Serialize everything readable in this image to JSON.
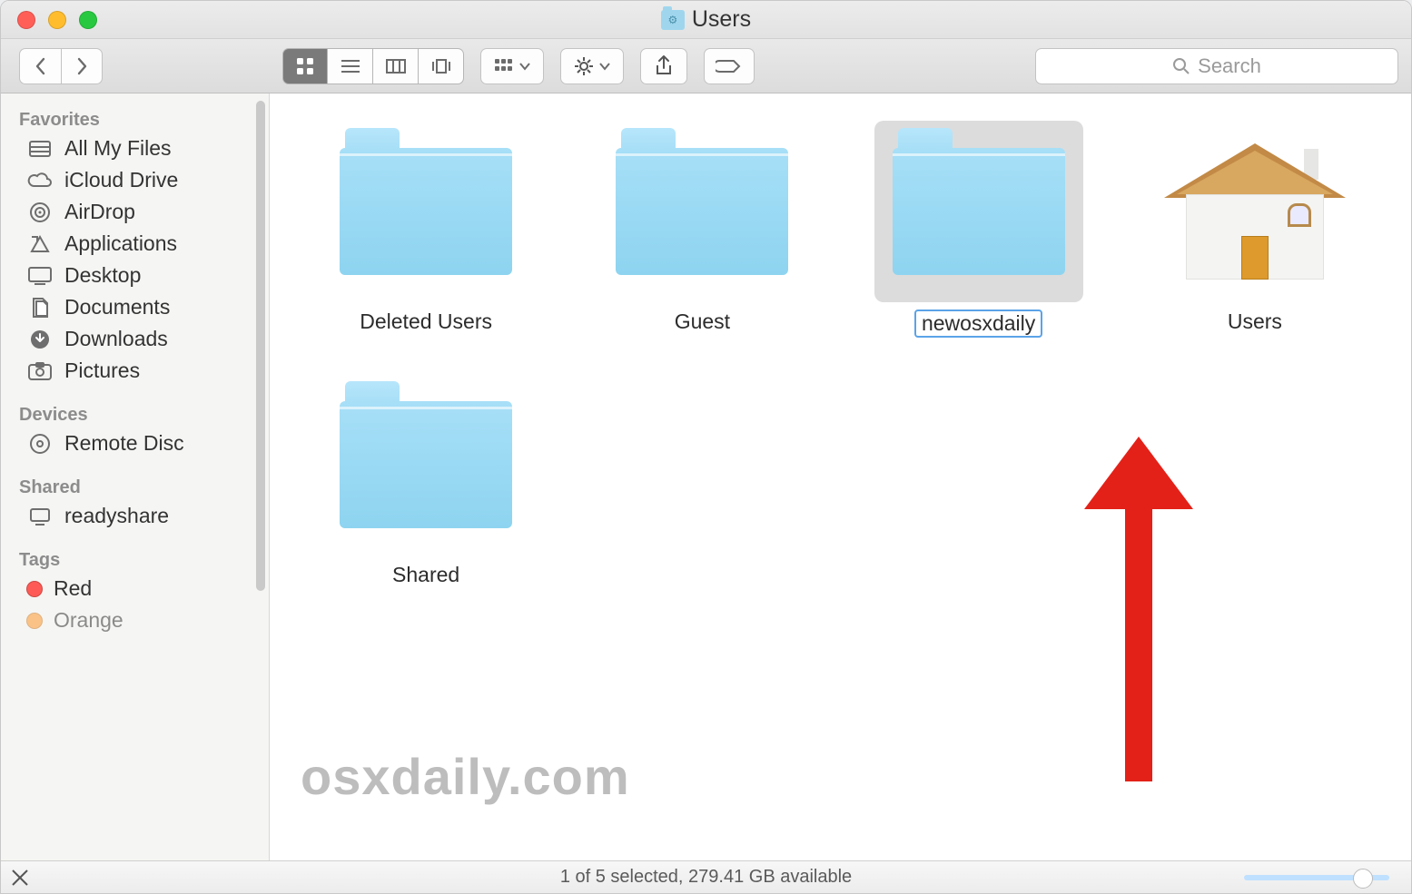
{
  "window": {
    "title": "Users"
  },
  "toolbar": {
    "search_placeholder": "Search"
  },
  "sidebar": {
    "favorites_heading": "Favorites",
    "devices_heading": "Devices",
    "shared_heading": "Shared",
    "tags_heading": "Tags",
    "favorites": [
      {
        "label": "All My Files",
        "icon": "all-files"
      },
      {
        "label": "iCloud Drive",
        "icon": "cloud"
      },
      {
        "label": "AirDrop",
        "icon": "airdrop"
      },
      {
        "label": "Applications",
        "icon": "apps"
      },
      {
        "label": "Desktop",
        "icon": "desktop"
      },
      {
        "label": "Documents",
        "icon": "documents"
      },
      {
        "label": "Downloads",
        "icon": "downloads"
      },
      {
        "label": "Pictures",
        "icon": "pictures"
      }
    ],
    "devices": [
      {
        "label": "Remote Disc",
        "icon": "disc"
      }
    ],
    "shared": [
      {
        "label": "readyshare",
        "icon": "monitor"
      }
    ],
    "tags": [
      {
        "label": "Red",
        "color": "#ff5b56"
      },
      {
        "label": "Orange",
        "color": "#ff9a2e"
      }
    ]
  },
  "items": [
    {
      "name": "Deleted Users",
      "type": "folder",
      "selected": false
    },
    {
      "name": "Guest",
      "type": "folder",
      "selected": false
    },
    {
      "name": "newosxdaily",
      "type": "folder",
      "selected": true,
      "editing": true
    },
    {
      "name": "Users",
      "type": "home",
      "selected": false
    },
    {
      "name": "Shared",
      "type": "folder",
      "selected": false
    }
  ],
  "status": {
    "text": "1 of 5 selected, 279.41 GB available"
  },
  "watermark": "osxdaily.com"
}
